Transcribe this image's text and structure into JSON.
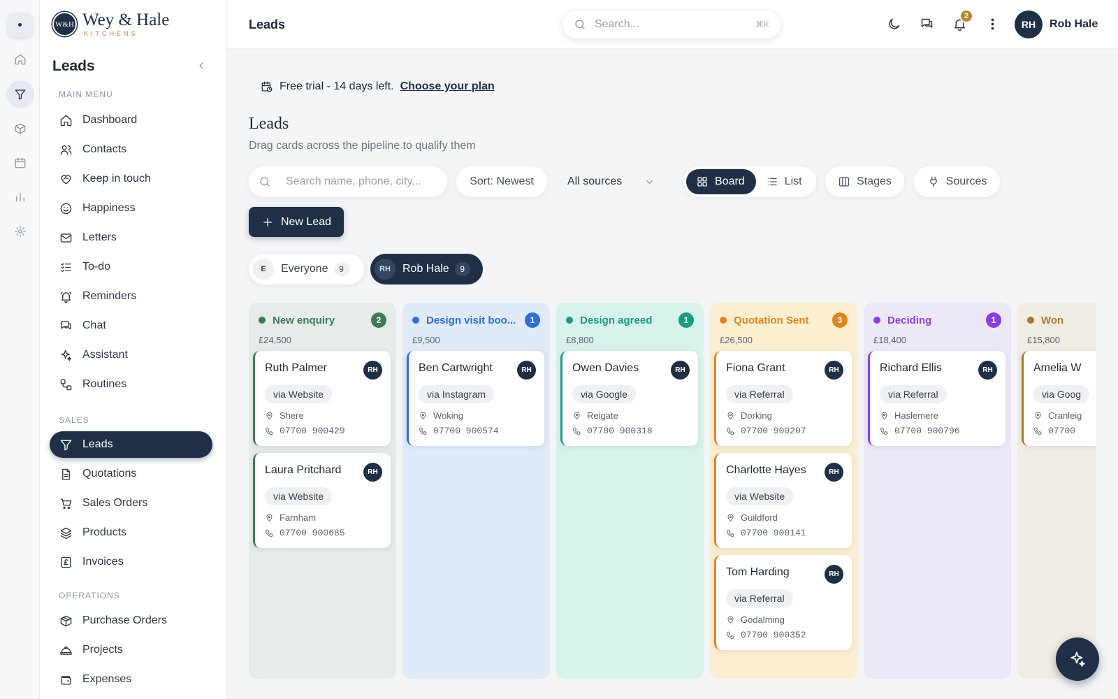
{
  "brand": {
    "badge": "W&H",
    "name": "Wey & Hale",
    "sub": "KITCHENS"
  },
  "sidebar": {
    "title": "Leads",
    "sections": {
      "main": "MAIN MENU",
      "sales": "SALES",
      "operations": "OPERATIONS"
    },
    "main_items": [
      "Dashboard",
      "Contacts",
      "Keep in touch",
      "Happiness",
      "Letters",
      "To-do",
      "Reminders",
      "Chat",
      "Assistant",
      "Routines"
    ],
    "sales_items": [
      "Leads",
      "Quotations",
      "Sales Orders",
      "Products",
      "Invoices"
    ],
    "operations_items": [
      "Purchase Orders",
      "Projects",
      "Expenses"
    ]
  },
  "topbar": {
    "title": "Leads",
    "search_placeholder": "Search...",
    "search_shortcut": "⌘K",
    "notification_count": "2",
    "user_initials": "RH",
    "user_name": "Rob Hale"
  },
  "main": {
    "trial_text": "Free trial - 14 days left.",
    "trial_link": "Choose your plan",
    "heading": "Leads",
    "subheading": "Drag cards across the pipeline to qualify them",
    "lead_search_placeholder": "Search name, phone, city...",
    "sort_label": "Sort: Newest",
    "source_filter": "All sources",
    "view_board": "Board",
    "view_list": "List",
    "stages_label": "Stages",
    "sources_label": "Sources",
    "new_lead_label": "New Lead",
    "owners": [
      {
        "initial": "E",
        "label": "Everyone",
        "count": "9"
      },
      {
        "initial": "RH",
        "label": "Rob Hale",
        "count": "9"
      }
    ]
  },
  "board": {
    "columns": [
      {
        "name": "New enquiry",
        "count": "2",
        "total": "£24,500",
        "accent": "#3f7a58",
        "bg": "#e6ece8",
        "cards": [
          {
            "name": "Ruth Palmer",
            "initials": "RH",
            "source": "via Website",
            "town": "Shere",
            "phone": "07700 900429"
          },
          {
            "name": "Laura Pritchard",
            "initials": "RH",
            "source": "via Website",
            "town": "Farnham",
            "phone": "07700 900685"
          }
        ]
      },
      {
        "name": "Design visit boo...",
        "count": "1",
        "total": "£9,500",
        "accent": "#2f6fd8",
        "bg": "#e1ebf8",
        "cards": [
          {
            "name": "Ben Cartwright",
            "initials": "RH",
            "source": "via Instagram",
            "town": "Woking",
            "phone": "07700 900574"
          }
        ]
      },
      {
        "name": "Design agreed",
        "count": "1",
        "total": "£8,800",
        "accent": "#1c9a84",
        "bg": "#d7f3ec",
        "cards": [
          {
            "name": "Owen Davies",
            "initials": "RH",
            "source": "via Google",
            "town": "Reigate",
            "phone": "07700 900318"
          }
        ]
      },
      {
        "name": "Quotation Sent",
        "count": "3",
        "total": "£26,500",
        "accent": "#e0861e",
        "bg": "#fbefd2",
        "cards": [
          {
            "name": "Fiona Grant",
            "initials": "RH",
            "source": "via Referral",
            "town": "Dorking",
            "phone": "07700 900207"
          },
          {
            "name": "Charlotte Hayes",
            "initials": "RH",
            "source": "via Website",
            "town": "Guildford",
            "phone": "07700 900141"
          },
          {
            "name": "Tom Harding",
            "initials": "RH",
            "source": "via Referral",
            "town": "Godalming",
            "phone": "07700 900352"
          }
        ]
      },
      {
        "name": "Deciding",
        "count": "1",
        "total": "£18,400",
        "accent": "#8b3fe0",
        "bg": "#ede8f7",
        "cards": [
          {
            "name": "Richard Ellis",
            "initials": "RH",
            "source": "via Referral",
            "town": "Haslemere",
            "phone": "07700 900796"
          }
        ]
      },
      {
        "name": "Won",
        "count": "",
        "total": "£15,800",
        "accent": "#a87a2e",
        "bg": "#f1ede4",
        "cards": [
          {
            "name": "Amelia W",
            "initials": "",
            "source": "via Goog",
            "town": "Cranleig",
            "phone": "07700"
          }
        ]
      }
    ]
  },
  "colors": {
    "brand_navy": "#1e2f46",
    "brand_gold": "#b88634"
  }
}
